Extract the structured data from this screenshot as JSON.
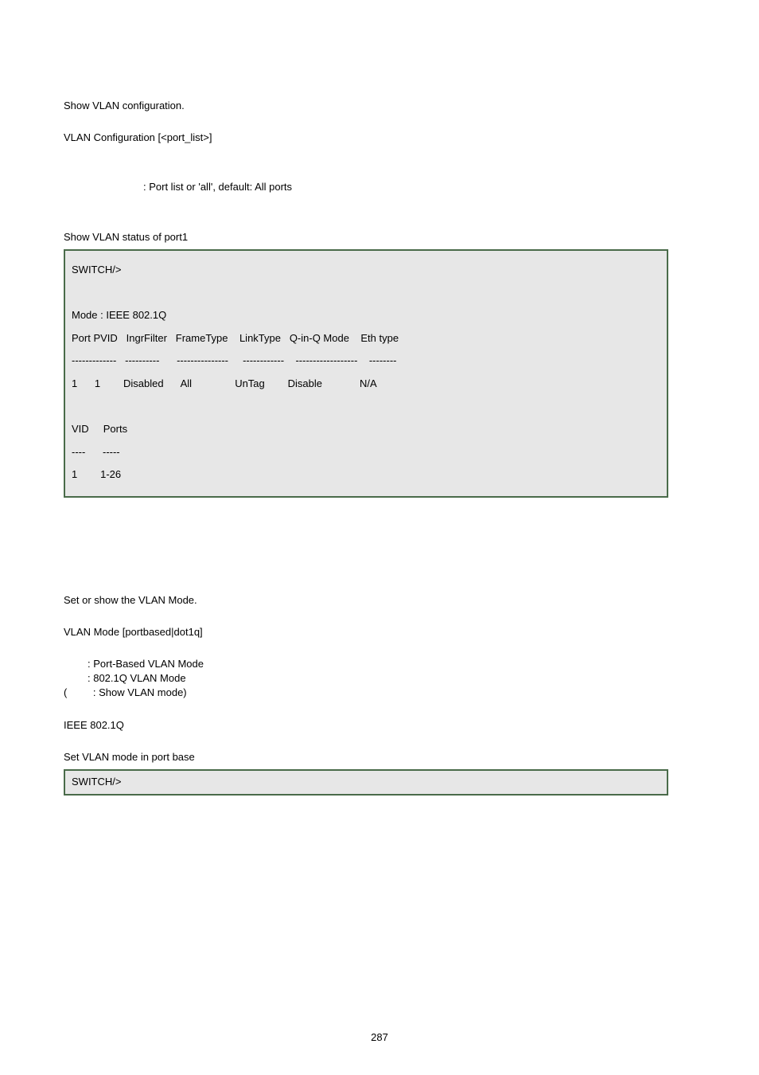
{
  "section1": {
    "desc": "Show VLAN configuration.",
    "syntax": "VLAN Configuration [<port_list>]",
    "param": ": Port list or 'all', default: All ports",
    "example_label": "Show VLAN status of port1",
    "terminal": "SWITCH/>\n\nMode : IEEE 802.1Q\nPort PVID   IngrFilter   FrameType    LinkType   Q-in-Q Mode    Eth type\n-------------   ----------      ---------------     ------------    ------------------    --------\n1      1        Disabled      All               UnTag        Disable             N/A\n\nVID     Ports\n----      -----\n1        1-26"
  },
  "section2": {
    "desc": "Set or show the VLAN Mode.",
    "syntax": "VLAN Mode [portbased|dot1q]",
    "param1": ": Port-Based VLAN Mode",
    "param2": ": 802.1Q VLAN Mode",
    "param3_open": "(",
    "param3_rest": ": Show VLAN mode)",
    "default": "IEEE 802.1Q",
    "example_label": "Set VLAN mode in port base",
    "terminal": "SWITCH/>"
  },
  "page_number": "287"
}
